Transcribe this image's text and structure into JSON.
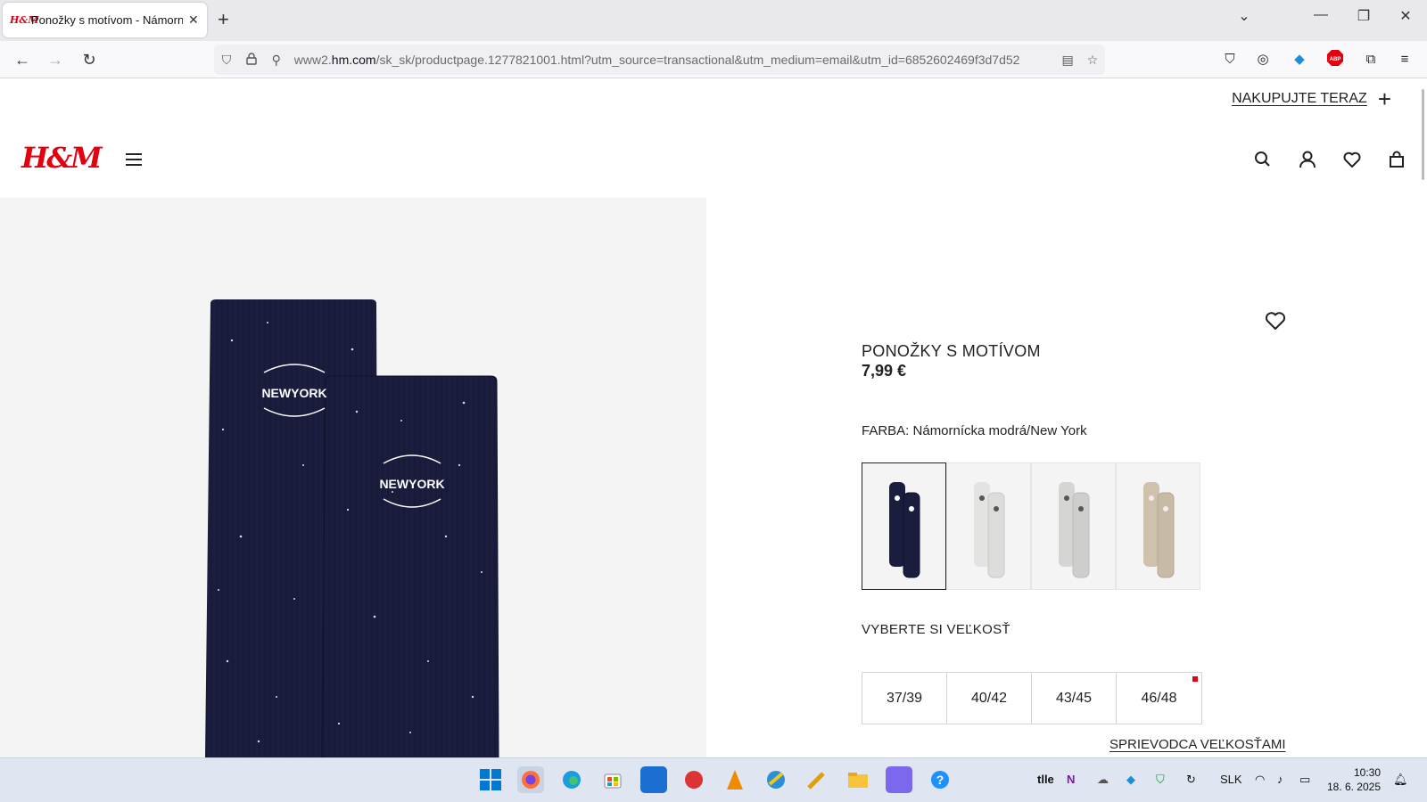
{
  "browser": {
    "tab_favicon": "H&M",
    "tab_title": "Ponožky s motívom - Námornícka",
    "url_prefix": "www2.",
    "url_domain": "hm.com",
    "url_rest": "/sk_sk/productpage.1277821001.html?utm_source=transactional&utm_medium=email&utm_id=6852602469f3d7d52"
  },
  "header": {
    "shop_now": "NAKUPUJTE TERAZ",
    "logo": "H&M"
  },
  "product": {
    "name": "PONOŽKY S MOTÍVOM",
    "price": "7,99 €",
    "color_label": "FARBA: Námornícka modrá/New York",
    "swatches": [
      {
        "name": "navy",
        "sock_color": "#1b1d3f"
      },
      {
        "name": "light-grey",
        "sock_color": "#e3e3e1"
      },
      {
        "name": "grey",
        "sock_color": "#d5d5d3"
      },
      {
        "name": "beige",
        "sock_color": "#cfc2ad"
      }
    ],
    "size_label": "VYBERTE SI VEĽKOSŤ",
    "sizes": [
      "37/39",
      "40/42",
      "43/45",
      "46/48"
    ],
    "size_guide": "SPRIEVODCA VEĽKOSŤAMI",
    "embroidery": "NEWYORK"
  },
  "taskbar": {
    "tray_text": "tlle",
    "language": "SLK",
    "time": "10:30",
    "date": "18. 6. 2025"
  },
  "colors": {
    "brand": "#e50010",
    "navy": "#1b1d3f"
  }
}
